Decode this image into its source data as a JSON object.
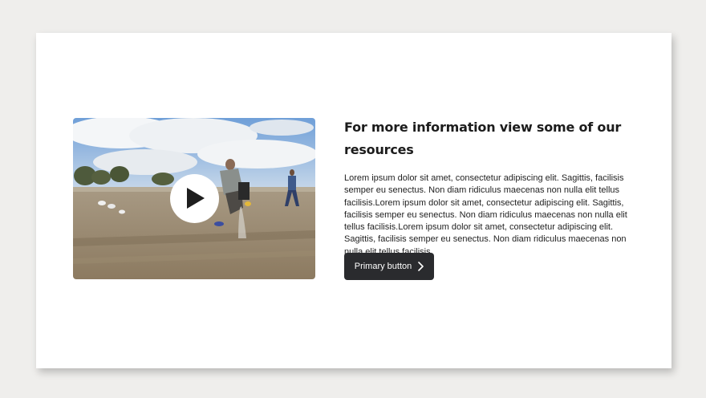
{
  "section": {
    "heading": "For more information view some of our resources",
    "body": "Lorem ipsum dolor sit amet, consectetur adipiscing elit. Sagittis, facilisis semper eu senectus. Non diam ridiculus maecenas non nulla elit tellus facilisis.Lorem ipsum dolor sit amet, consectetur adipiscing elit. Sagittis, facilisis semper eu senectus. Non diam ridiculus maecenas non nulla elit tellus facilisis.Lorem ipsum dolor sit amet, consectetur adipiscing elit. Sagittis, facilisis semper eu senectus. Non diam ridiculus maecenas non nulla elit tellus facilisis.",
    "button_label": "Primary button"
  },
  "video": {
    "icon": "play-icon"
  },
  "colors": {
    "button_bg": "#2a2b2e",
    "page_bg": "#efeeec",
    "card_bg": "#ffffff"
  }
}
